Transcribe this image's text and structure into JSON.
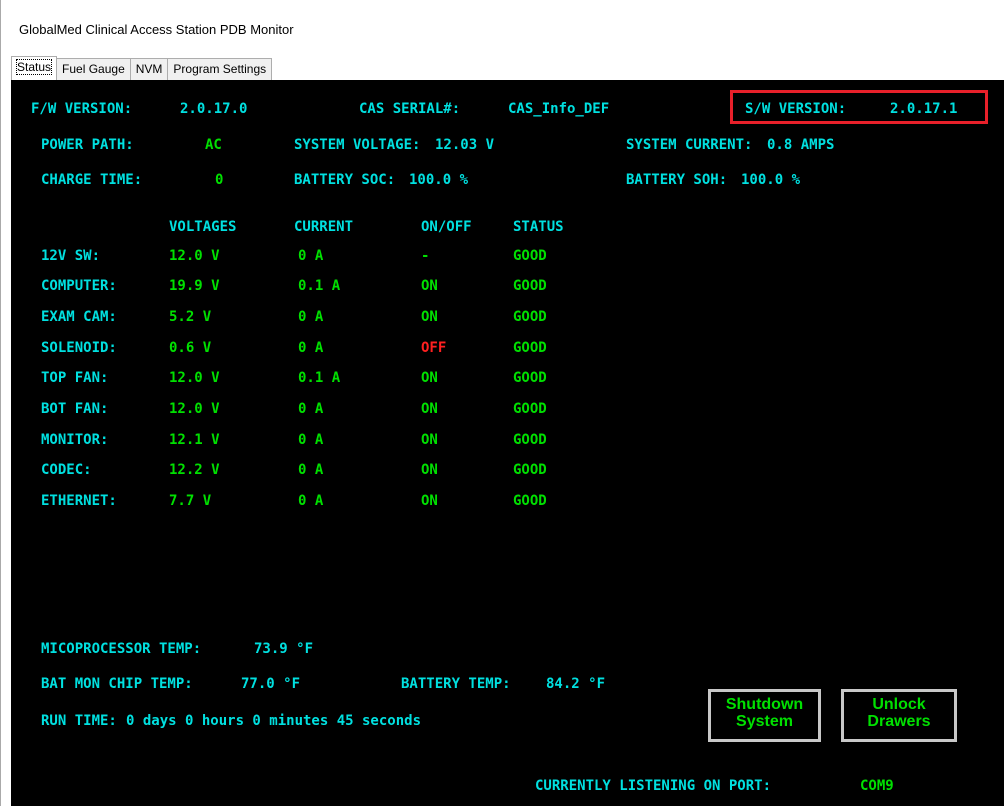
{
  "window": {
    "title": "GlobalMed Clinical Access Station PDB Monitor"
  },
  "tabs": [
    {
      "label": "Status",
      "active": true
    },
    {
      "label": "Fuel Gauge",
      "active": false
    },
    {
      "label": "NVM",
      "active": false
    },
    {
      "label": "Program Settings",
      "active": false
    }
  ],
  "header": {
    "fw_label": "F/W VERSION:",
    "fw_value": "2.0.17.0",
    "cas_label": "CAS SERIAL#:",
    "cas_value": "CAS_Info_DEF",
    "sw_label": "S/W VERSION:",
    "sw_value": "2.0.17.1",
    "power_path_label": "POWER PATH:",
    "power_path_value": "AC",
    "sys_voltage_label": "SYSTEM VOLTAGE:",
    "sys_voltage_value": "12.03 V",
    "sys_current_label": "SYSTEM CURRENT:",
    "sys_current_value": "0.8 AMPS",
    "charge_time_label": "CHARGE TIME:",
    "charge_time_value": "0",
    "battery_soc_label": "BATTERY SOC:",
    "battery_soc_value": "100.0 %",
    "battery_soh_label": "BATTERY SOH:",
    "battery_soh_value": "100.0 %"
  },
  "table": {
    "headers": [
      "VOLTAGES",
      "CURRENT",
      "ON/OFF",
      "STATUS"
    ],
    "rows": [
      {
        "name": "12V SW:",
        "voltage": "12.0 V",
        "current": "0 A",
        "onoff": "-",
        "status": "GOOD"
      },
      {
        "name": "COMPUTER:",
        "voltage": "19.9 V",
        "current": "0.1 A",
        "onoff": "ON",
        "status": "GOOD"
      },
      {
        "name": "EXAM CAM:",
        "voltage": "5.2 V",
        "current": "0 A",
        "onoff": "ON",
        "status": "GOOD"
      },
      {
        "name": "SOLENOID:",
        "voltage": "0.6 V",
        "current": "0 A",
        "onoff": "OFF",
        "status": "GOOD"
      },
      {
        "name": "TOP FAN:",
        "voltage": "12.0 V",
        "current": "0.1 A",
        "onoff": "ON",
        "status": "GOOD"
      },
      {
        "name": "BOT FAN:",
        "voltage": "12.0 V",
        "current": "0 A",
        "onoff": "ON",
        "status": "GOOD"
      },
      {
        "name": "MONITOR:",
        "voltage": "12.1 V",
        "current": "0 A",
        "onoff": "ON",
        "status": "GOOD"
      },
      {
        "name": "CODEC:",
        "voltage": "12.2 V",
        "current": "0 A",
        "onoff": "ON",
        "status": "GOOD"
      },
      {
        "name": "ETHERNET:",
        "voltage": "7.7 V",
        "current": "0 A",
        "onoff": "ON",
        "status": "GOOD"
      }
    ]
  },
  "temps": {
    "micro_label": "MICOPROCESSOR TEMP:",
    "micro_value": "73.9 °F",
    "batmon_label": "BAT MON CHIP TEMP:",
    "batmon_value": "77.0 °F",
    "battemp_label": "BATTERY TEMP:",
    "battemp_value": "84.2 °F"
  },
  "runtime": {
    "label": "RUN TIME:",
    "value": "0 days 0 hours 0 minutes 45 seconds"
  },
  "buttons": {
    "shutdown_line1": "Shutdown",
    "shutdown_line2": "System",
    "unlock_line1": "Unlock",
    "unlock_line2": "Drawers"
  },
  "footer": {
    "port_label": "CURRENTLY LISTENING ON PORT:",
    "port_value": "COM9"
  },
  "colors": {
    "label": "#00e0e0",
    "value": "#00e000",
    "off": "#ff2020",
    "highlight": "#e8202a",
    "background": "#000000"
  }
}
